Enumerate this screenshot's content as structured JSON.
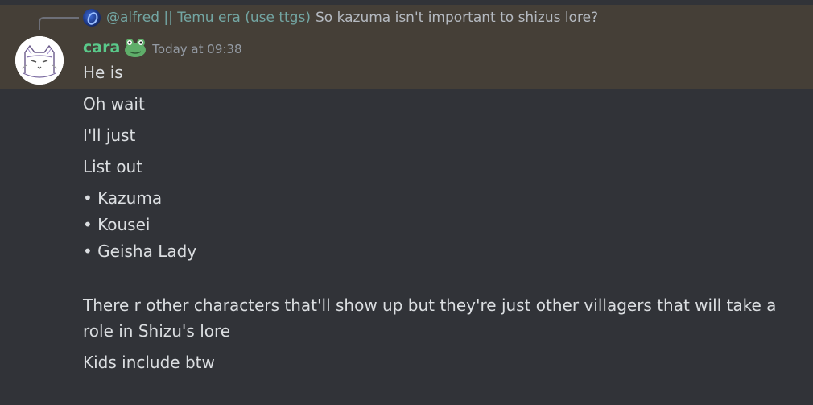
{
  "reply": {
    "author": "@alfred || Temu era (use ttgs)",
    "text": "So kazuma isn't important to shizus lore?"
  },
  "message": {
    "username": "cara",
    "timestamp": "Today at 09:38",
    "lines": [
      "He is",
      "Oh wait",
      "I'll just",
      "List out",
      "• Kazuma",
      "• Kousei",
      "• Geisha Lady",
      "There r other characters that'll show up but they're just other villagers that will take a",
      "role in Shizu's lore",
      "Kids include btw"
    ]
  },
  "colors": {
    "background": "#313338",
    "highlight": "#453f37",
    "username": "#5ac98a",
    "reply_author": "#73a6a3"
  },
  "icons": {
    "reply_avatar": "blue-abstract-avatar-icon",
    "avatar": "cat-sketch-avatar",
    "role_icon": "frog-icon"
  }
}
